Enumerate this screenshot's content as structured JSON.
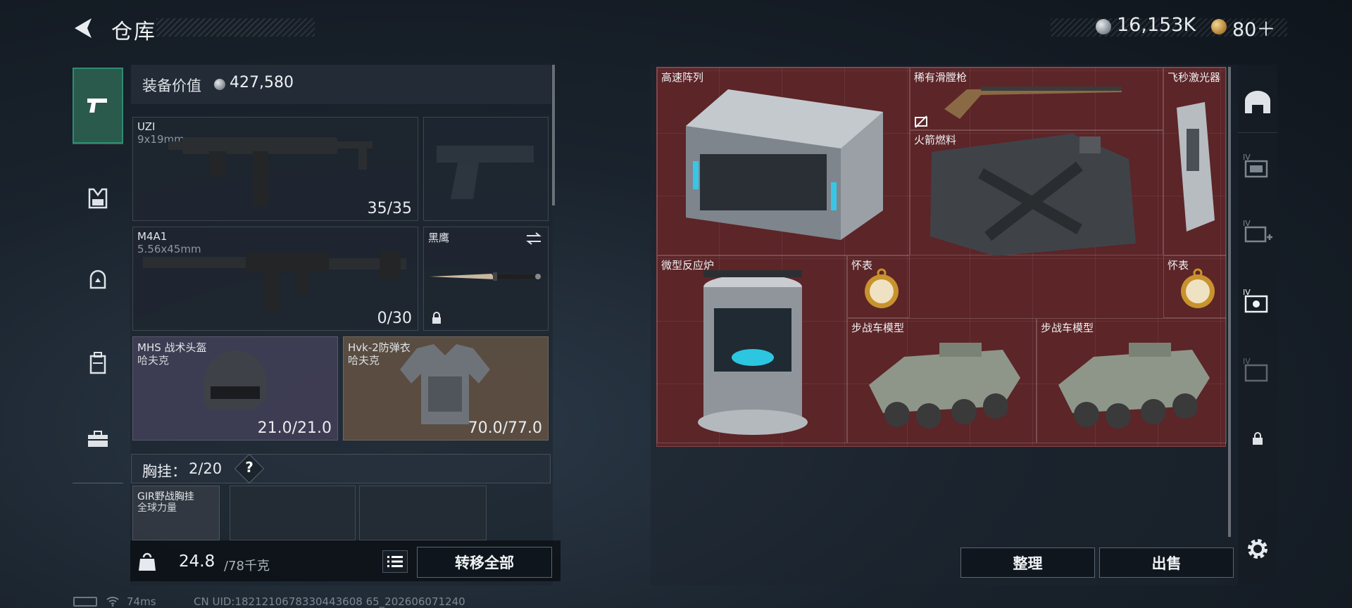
{
  "header": {
    "title": "仓库",
    "currency_silver": "16,153K",
    "currency_gold": "80＋"
  },
  "sidebar": {
    "items": [
      {
        "icon": "pistol-icon",
        "active": true
      },
      {
        "icon": "armor-icon"
      },
      {
        "icon": "helmet-icon"
      },
      {
        "icon": "backpack-icon"
      },
      {
        "icon": "toolbox-icon"
      }
    ]
  },
  "equipment": {
    "value_label": "装备价值",
    "value": "427,580",
    "weapons": [
      {
        "name": "UZI",
        "ammo_type": "9x19mm",
        "ammo": "35/35"
      },
      {
        "name": "M4A1",
        "ammo_type": "5.56x45mm",
        "ammo": "0/30"
      }
    ],
    "melee": {
      "name": "黑鹰"
    },
    "helmet": {
      "name": "MHS 战术头盔",
      "brand": "哈夫克",
      "durability": "21.0/21.0"
    },
    "armor": {
      "name": "Hvk-2防弹衣",
      "brand": "哈夫克",
      "durability": "70.0/77.0"
    },
    "chest_rig": {
      "label": "胸挂：",
      "count": "2/20",
      "help": "?",
      "item_name": "GIR野战胸挂",
      "item_brand": "全球力量"
    }
  },
  "footer": {
    "weight_current": "24.8",
    "weight_max": "/78千克",
    "transfer_all": "转移全部",
    "ping": "74ms",
    "uid": "CN UID:1821210678330443608 65_202606071240"
  },
  "stash": {
    "items": [
      {
        "name": "高速阵列"
      },
      {
        "name": "稀有滑膛枪"
      },
      {
        "name": "飞秒激光器"
      },
      {
        "name": "火箭燃料"
      },
      {
        "name": "微型反应炉"
      },
      {
        "name": "怀表"
      },
      {
        "name": "怀表"
      },
      {
        "name": "步战车模型"
      },
      {
        "name": "步战车模型"
      }
    ],
    "sort": "整理",
    "sell": "出售"
  },
  "right_sidebar": {
    "items": [
      "shelter-icon",
      "storage-iv-icon",
      "storage-iv-add-icon",
      "storage-iv-camera-icon",
      "storage-iv-locked-icon",
      "lock-icon"
    ]
  },
  "colors": {
    "stash_bg": "#5c2528",
    "accent_green": "#2f8c73"
  }
}
